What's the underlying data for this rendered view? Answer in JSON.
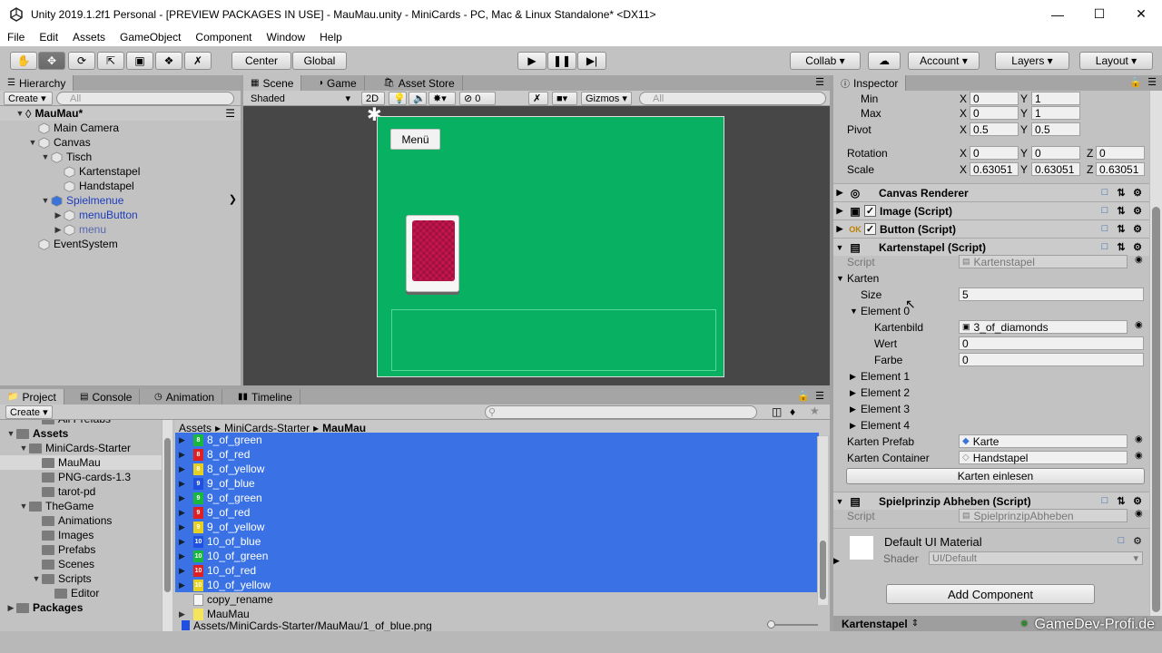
{
  "window": {
    "title": "Unity 2019.1.2f1 Personal - [PREVIEW PACKAGES IN USE] - MauMau.unity - MiniCards - PC, Mac & Linux Standalone* <DX11>"
  },
  "menu": [
    "File",
    "Edit",
    "Assets",
    "GameObject",
    "Component",
    "Window",
    "Help"
  ],
  "toolbar": {
    "center": "Center",
    "global": "Global",
    "collab": "Collab",
    "account": "Account",
    "layers": "Layers",
    "layout": "Layout"
  },
  "hierarchy": {
    "tab": "Hierarchy",
    "create": "Create",
    "search_placeholder": "All",
    "scene": "MauMau*",
    "items": [
      {
        "label": "Main Camera",
        "depth": 1,
        "arrow": "",
        "style": ""
      },
      {
        "label": "Canvas",
        "depth": 1,
        "arrow": "▼",
        "style": ""
      },
      {
        "label": "Tisch",
        "depth": 2,
        "arrow": "▼",
        "style": ""
      },
      {
        "label": "Kartenstapel",
        "depth": 3,
        "arrow": "",
        "style": ""
      },
      {
        "label": "Handstapel",
        "depth": 3,
        "arrow": "",
        "style": ""
      },
      {
        "label": "Spielmenue",
        "depth": 2,
        "arrow": "▼",
        "style": "blue"
      },
      {
        "label": "menuButton",
        "depth": 3,
        "arrow": "▶",
        "style": "blue"
      },
      {
        "label": "menu",
        "depth": 3,
        "arrow": "▶",
        "style": "faded"
      },
      {
        "label": "EventSystem",
        "depth": 1,
        "arrow": "",
        "style": ""
      }
    ]
  },
  "scene": {
    "tabs": [
      "Scene",
      "Game",
      "Asset Store"
    ],
    "shading": "Shaded",
    "mode_2d": "2D",
    "hidden_count": "0",
    "gizmos": "Gizmos",
    "search_placeholder": "All",
    "menu_button": "Menü"
  },
  "inspector": {
    "tab": "Inspector",
    "rows": {
      "min": {
        "label": "Min",
        "x": "0",
        "y": "1"
      },
      "max": {
        "label": "Max",
        "x": "0",
        "y": "1"
      },
      "pivot": {
        "label": "Pivot",
        "x": "0.5",
        "y": "0.5"
      },
      "rotation": {
        "label": "Rotation",
        "x": "0",
        "y": "0",
        "z": "0"
      },
      "scale": {
        "label": "Scale",
        "x": "0.63051",
        "y": "0.63051",
        "z": "0.63051"
      }
    },
    "components": {
      "canvas_renderer": "Canvas Renderer",
      "image": "Image (Script)",
      "button": "Button (Script)",
      "kartenstapel": "Kartenstapel (Script)",
      "spielprinzip": "Spielprinzip Abheben (Script)"
    },
    "kartenstapel": {
      "script_label": "Script",
      "script_value": "Kartenstapel",
      "karten": "Karten",
      "size_label": "Size",
      "size_value": "5",
      "element0": "Element 0",
      "kartenbild_label": "Kartenbild",
      "kartenbild_value": "3_of_diamonds",
      "wert_label": "Wert",
      "wert_value": "0",
      "farbe_label": "Farbe",
      "farbe_value": "0",
      "elements": [
        "Element 1",
        "Element 2",
        "Element 3",
        "Element 4"
      ],
      "prefab_label": "Karten Prefab",
      "prefab_value": "Karte",
      "container_label": "Karten Container",
      "container_value": "Handstapel",
      "einlesen": "Karten einlesen"
    },
    "spielprinzip": {
      "script_label": "Script",
      "script_value": "SpielprinzipAbheben"
    },
    "material": {
      "name": "Default UI Material",
      "shader_label": "Shader",
      "shader_value": "UI/Default"
    },
    "add_component": "Add Component",
    "footer": "Kartenstapel",
    "watermark": "GameDev-Profi.de"
  },
  "project": {
    "tabs": [
      "Project",
      "Console",
      "Animation",
      "Timeline"
    ],
    "create": "Create",
    "breadcrumb": [
      "Assets",
      "MiniCards-Starter",
      "MauMau"
    ],
    "tree": [
      {
        "label": "All Prefabs",
        "depth": 2,
        "arrow": ""
      },
      {
        "label": "Assets",
        "depth": 0,
        "arrow": "▼",
        "bold": true
      },
      {
        "label": "MiniCards-Starter",
        "depth": 1,
        "arrow": "▼"
      },
      {
        "label": "MauMau",
        "depth": 2,
        "arrow": "",
        "selected": true
      },
      {
        "label": "PNG-cards-1.3",
        "depth": 2,
        "arrow": ""
      },
      {
        "label": "tarot-pd",
        "depth": 2,
        "arrow": ""
      },
      {
        "label": "TheGame",
        "depth": 1,
        "arrow": "▼"
      },
      {
        "label": "Animations",
        "depth": 2,
        "arrow": ""
      },
      {
        "label": "Images",
        "depth": 2,
        "arrow": ""
      },
      {
        "label": "Prefabs",
        "depth": 2,
        "arrow": ""
      },
      {
        "label": "Scenes",
        "depth": 2,
        "arrow": ""
      },
      {
        "label": "Scripts",
        "depth": 2,
        "arrow": "▼"
      },
      {
        "label": "Editor",
        "depth": 3,
        "arrow": ""
      },
      {
        "label": "Packages",
        "depth": 0,
        "arrow": "▶",
        "bold": true
      }
    ],
    "files": [
      {
        "label": "8_of_green",
        "color": "#18b83c",
        "num": "8",
        "sel": true
      },
      {
        "label": "8_of_red",
        "color": "#e02020",
        "num": "8",
        "sel": true
      },
      {
        "label": "8_of_yellow",
        "color": "#e8d020",
        "num": "8",
        "sel": true
      },
      {
        "label": "9_of_blue",
        "color": "#2050e0",
        "num": "9",
        "sel": true
      },
      {
        "label": "9_of_green",
        "color": "#18b83c",
        "num": "9",
        "sel": true
      },
      {
        "label": "9_of_red",
        "color": "#e02020",
        "num": "9",
        "sel": true
      },
      {
        "label": "9_of_yellow",
        "color": "#e8d020",
        "num": "9",
        "sel": true
      },
      {
        "label": "10_of_blue",
        "color": "#2050e0",
        "num": "10",
        "sel": true
      },
      {
        "label": "10_of_green",
        "color": "#18b83c",
        "num": "10",
        "sel": true
      },
      {
        "label": "10_of_red",
        "color": "#e02020",
        "num": "10",
        "sel": true
      },
      {
        "label": "10_of_yellow",
        "color": "#e8d020",
        "num": "10",
        "sel": true
      },
      {
        "label": "copy_rename",
        "color": "",
        "num": "",
        "sel": false
      },
      {
        "label": "MauMau",
        "color": "",
        "num": "",
        "sel": false
      }
    ],
    "status_path": "Assets/MiniCards-Starter/MauMau/1_of_blue.png"
  },
  "colors": {
    "selection": "#3a72e6",
    "canvas_green": "#08b061",
    "card_back": "#c5154e"
  }
}
